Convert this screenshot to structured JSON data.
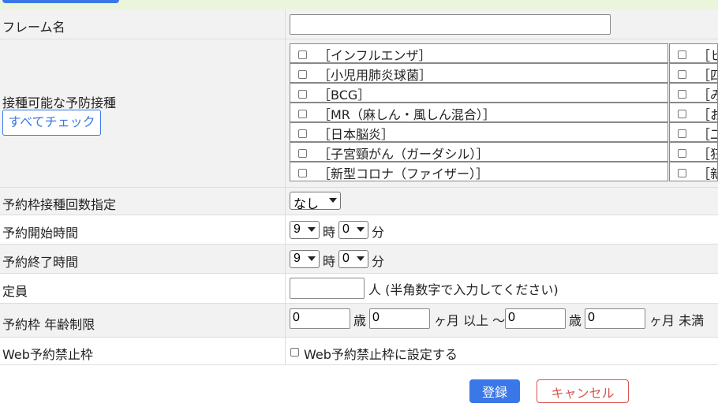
{
  "form": {
    "frame_name": {
      "label": "フレーム名",
      "value": ""
    },
    "vaccines": {
      "label": "接種可能な予防接種",
      "check_all_label": "すべてチェック",
      "column1": [
        "［インフルエンザ］",
        "［小児用肺炎球菌］",
        "［BCG］",
        "［MR（麻しん・風しん混合）］",
        "［日本脳炎］",
        "［子宮頸がん（ガーダシル）］",
        "［新型コロナ（ファイザー）］"
      ],
      "column2": [
        "［ヒ",
        "［四",
        "［み",
        "［お",
        "［二",
        "［狂",
        "［新"
      ]
    },
    "dose_count": {
      "label": "予約枠接種回数指定",
      "selected": "なし"
    },
    "start_time": {
      "label": "予約開始時間",
      "hour": "9",
      "hour_unit": "時",
      "minute": "0",
      "minute_unit": "分"
    },
    "end_time": {
      "label": "予約終了時間",
      "hour": "9",
      "hour_unit": "時",
      "minute": "0",
      "minute_unit": "分"
    },
    "capacity": {
      "label": "定員",
      "value": "",
      "hint": "人 (半角数字で入力してください)"
    },
    "age_limit": {
      "label": "予約枠 年齢制限",
      "from_years": "0",
      "years_unit": "歳",
      "from_months": "0",
      "from_suffix": "ヶ月 以上 〜",
      "to_years": "0",
      "to_years_unit": "歳",
      "to_months": "0",
      "to_suffix": "ヶ月 未満"
    },
    "web_block": {
      "label": "Web予約禁止枠",
      "checkbox_label": "Web予約禁止枠に設定する"
    }
  },
  "actions": {
    "submit_label": "登録",
    "cancel_label": "キャンセル"
  },
  "colors": {
    "primary": "#3b78e7",
    "danger": "#d9534f",
    "row_alt": "#f2f2f2",
    "top_strip": "#eaf5dc"
  }
}
